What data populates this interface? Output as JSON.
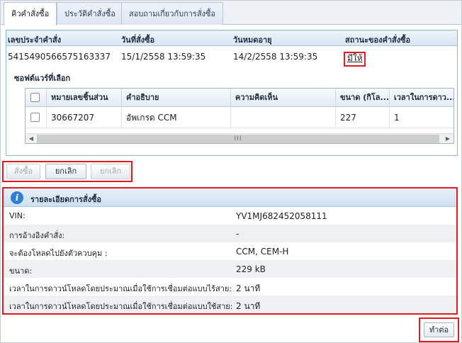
{
  "tabs": [
    {
      "label": "คิวคำสั่งซื้อ"
    },
    {
      "label": "ประวัติคำสั่งซื้อ"
    },
    {
      "label": "สอบถามเกี่ยวกับการสั่งซื้อ"
    }
  ],
  "order_table": {
    "headers": [
      "เลขประจำคำสั่ง",
      "วันที่สั่งซื้อ",
      "วันหมดอายุ",
      "สถานะของคำสั่งซื้อ"
    ],
    "row": {
      "order_id": "5415490566575163337",
      "order_date": "15/1/2558 13:59:35",
      "expiry_date": "14/2/2558 13:59:35",
      "status": "มีให้"
    }
  },
  "selected_software": {
    "title": "ซอฟต์แวร์ที่เลือก",
    "headers": [
      "หมายเลขชิ้นส่วน",
      "คำอธิบาย",
      "ความคิดเห็น",
      "ขนาด (กิโล...",
      "เวลาในการดาว..."
    ],
    "rows": [
      {
        "part_number": "30667207",
        "description": "อัพเกรด CCM",
        "comment": "",
        "size": "227",
        "time": "1"
      }
    ],
    "scroll_thumb": "III"
  },
  "actions": {
    "order_label": "สั่งซื้อ",
    "cancel_label": "ยกเลิก",
    "cancel_all_label": "ยกเลิก"
  },
  "order_details": {
    "title": "รายละเอียดการสั่งซื้อ",
    "info_icon": "i",
    "rows": [
      {
        "label": "VIN:",
        "value": "YV1MJ682452058111"
      },
      {
        "label": "การอ้างอิงคำสั่ง:",
        "value": "-"
      },
      {
        "label": "จะต้องโหลดไปยังตัวควบคุม :",
        "value": "CCM, CEM-H"
      },
      {
        "label": "ขนาด:",
        "value": "229 kB"
      },
      {
        "label": "เวลาในการดาวน์โหลดโดยประมาณเมื่อใช้การเชื่อมต่อแบบไร้สาย:",
        "value": "2 นาที"
      },
      {
        "label": "เวลาในการดาวน์โหลดโดยประมาณเมื่อใช้การเชื่อมต่อแบบใช้สาย:",
        "value": "2 นาที"
      }
    ]
  },
  "continue_label": "ทำต่อ",
  "colors": {
    "highlight": "#e01b22",
    "header_blue": "#d9e6f4",
    "info_icon": "#2f7fd1"
  }
}
